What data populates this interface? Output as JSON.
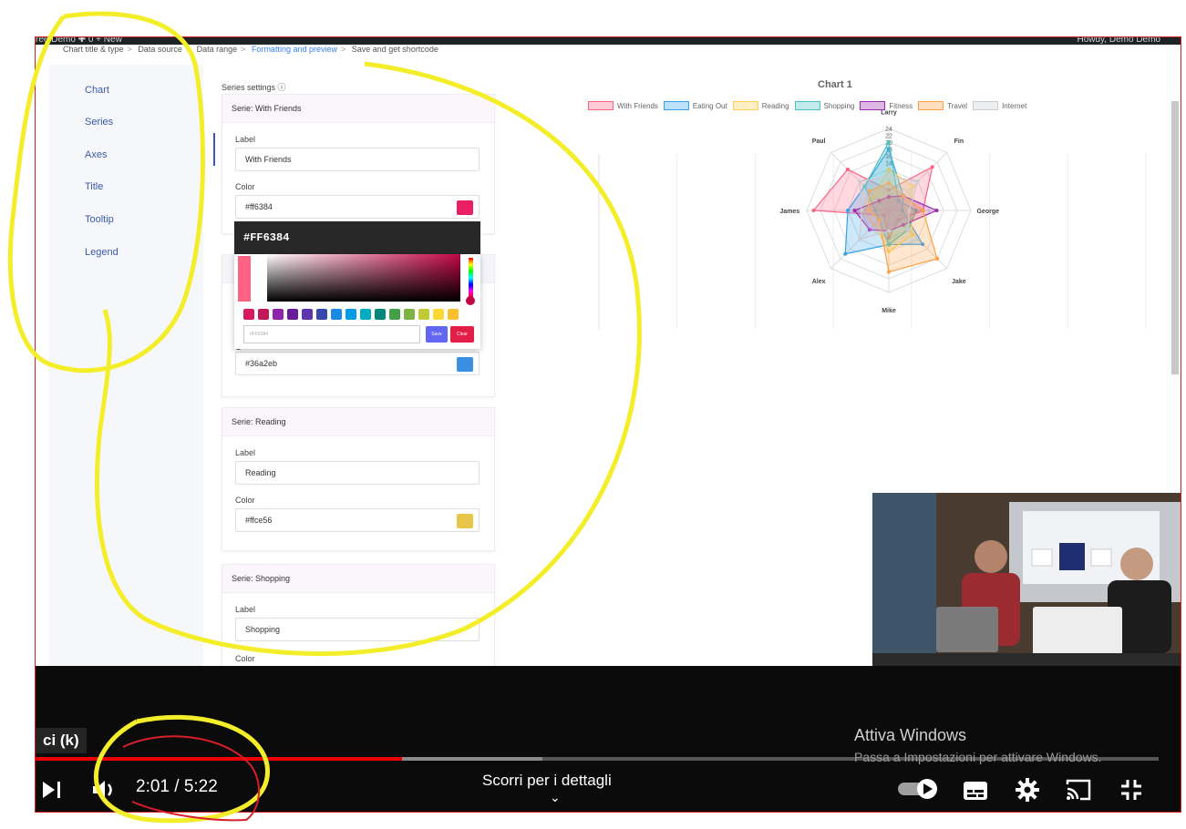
{
  "admin_bar": {
    "left_text": "ree Demo   ✚ 0   + New",
    "right_text": "Howdy, Demo Demo"
  },
  "breadcrumb": [
    "Chart title & type",
    "Data source",
    "Data range",
    "Formatting and preview",
    "Save and get shortcode"
  ],
  "tabs": [
    "Chart",
    "Series",
    "Axes",
    "Title",
    "Tooltip",
    "Legend"
  ],
  "series_settings": {
    "title": "Series settings ⓘ",
    "series": [
      {
        "header": "Serie: With Friends",
        "label_caption": "Label",
        "label_value": "With Friends",
        "color_caption": "Color",
        "color_value": "#ff6384",
        "swatch": "#e91e63"
      },
      {
        "color_value": "#36a2eb",
        "swatch": "#3b8fe0",
        "label_partial": "L",
        "color_partial": "C"
      },
      {
        "header": "Serie: Reading",
        "label_caption": "Label",
        "label_value": "Reading",
        "color_caption": "Color",
        "color_value": "#ffce56",
        "swatch": "#e7c64a"
      },
      {
        "header": "Serie: Shopping",
        "label_caption": "Label",
        "label_value": "Shopping",
        "color_caption": "Color"
      }
    ]
  },
  "color_picker": {
    "hex": "#FF6384",
    "input_placeholder": "#FF6384",
    "save": "Save",
    "clear": "Clear",
    "swatches": [
      "#d81b60",
      "#c2185b",
      "#8e24aa",
      "#6a1b9a",
      "#5e35b1",
      "#3949ab",
      "#1e88e5",
      "#039be5",
      "#00acc1",
      "#00897b",
      "#43a047",
      "#7cb342",
      "#c0ca33",
      "#fdd835",
      "#fbc02d"
    ]
  },
  "chart_data": {
    "type": "radar",
    "title": "Chart 1",
    "labels": [
      "Larry",
      "Fin",
      "George",
      "Jake",
      "Mike",
      "Alex",
      "James",
      "Paul"
    ],
    "tick_labels": [
      "24",
      "22",
      "20",
      "18",
      "16",
      "14"
    ],
    "series": [
      {
        "name": "With Friends",
        "color": "#ff6384",
        "values": [
          6,
          18,
          10,
          4,
          8,
          2,
          22,
          17
        ]
      },
      {
        "name": "Eating Out",
        "color": "#36a2eb",
        "values": [
          18,
          6,
          4,
          14,
          10,
          18,
          12,
          10
        ]
      },
      {
        "name": "Reading",
        "color": "#ffce56",
        "values": [
          12,
          10,
          6,
          10,
          12,
          6,
          8,
          6
        ]
      },
      {
        "name": "Shopping",
        "color": "#4bc0c0",
        "values": [
          20,
          4,
          8,
          8,
          10,
          4,
          4,
          10
        ]
      },
      {
        "name": "Fitness",
        "color": "#9c27b0",
        "values": [
          4,
          6,
          14,
          6,
          6,
          8,
          10,
          4
        ]
      },
      {
        "name": "Travel",
        "color": "#ff9f40",
        "values": [
          8,
          6,
          10,
          20,
          18,
          4,
          6,
          8
        ]
      },
      {
        "name": "Internet",
        "color": "#c9cbcf",
        "values": [
          10,
          12,
          6,
          8,
          6,
          12,
          8,
          12
        ]
      }
    ],
    "x_axis_labels": [
      "Larry",
      "Fin",
      "George",
      "Jake",
      "Mike",
      "Alex",
      "James",
      "Paul"
    ]
  },
  "player": {
    "tooltip": "ci (k)",
    "time": "2:01 / 5:22",
    "scroll_hint": "Scorri per i dettagli",
    "progress_played": 0.326,
    "progress_buffered": 0.451
  },
  "windows_watermark": {
    "line1": "Attiva Windows",
    "line2": "Passa a Impostazioni per attivare Windows."
  }
}
